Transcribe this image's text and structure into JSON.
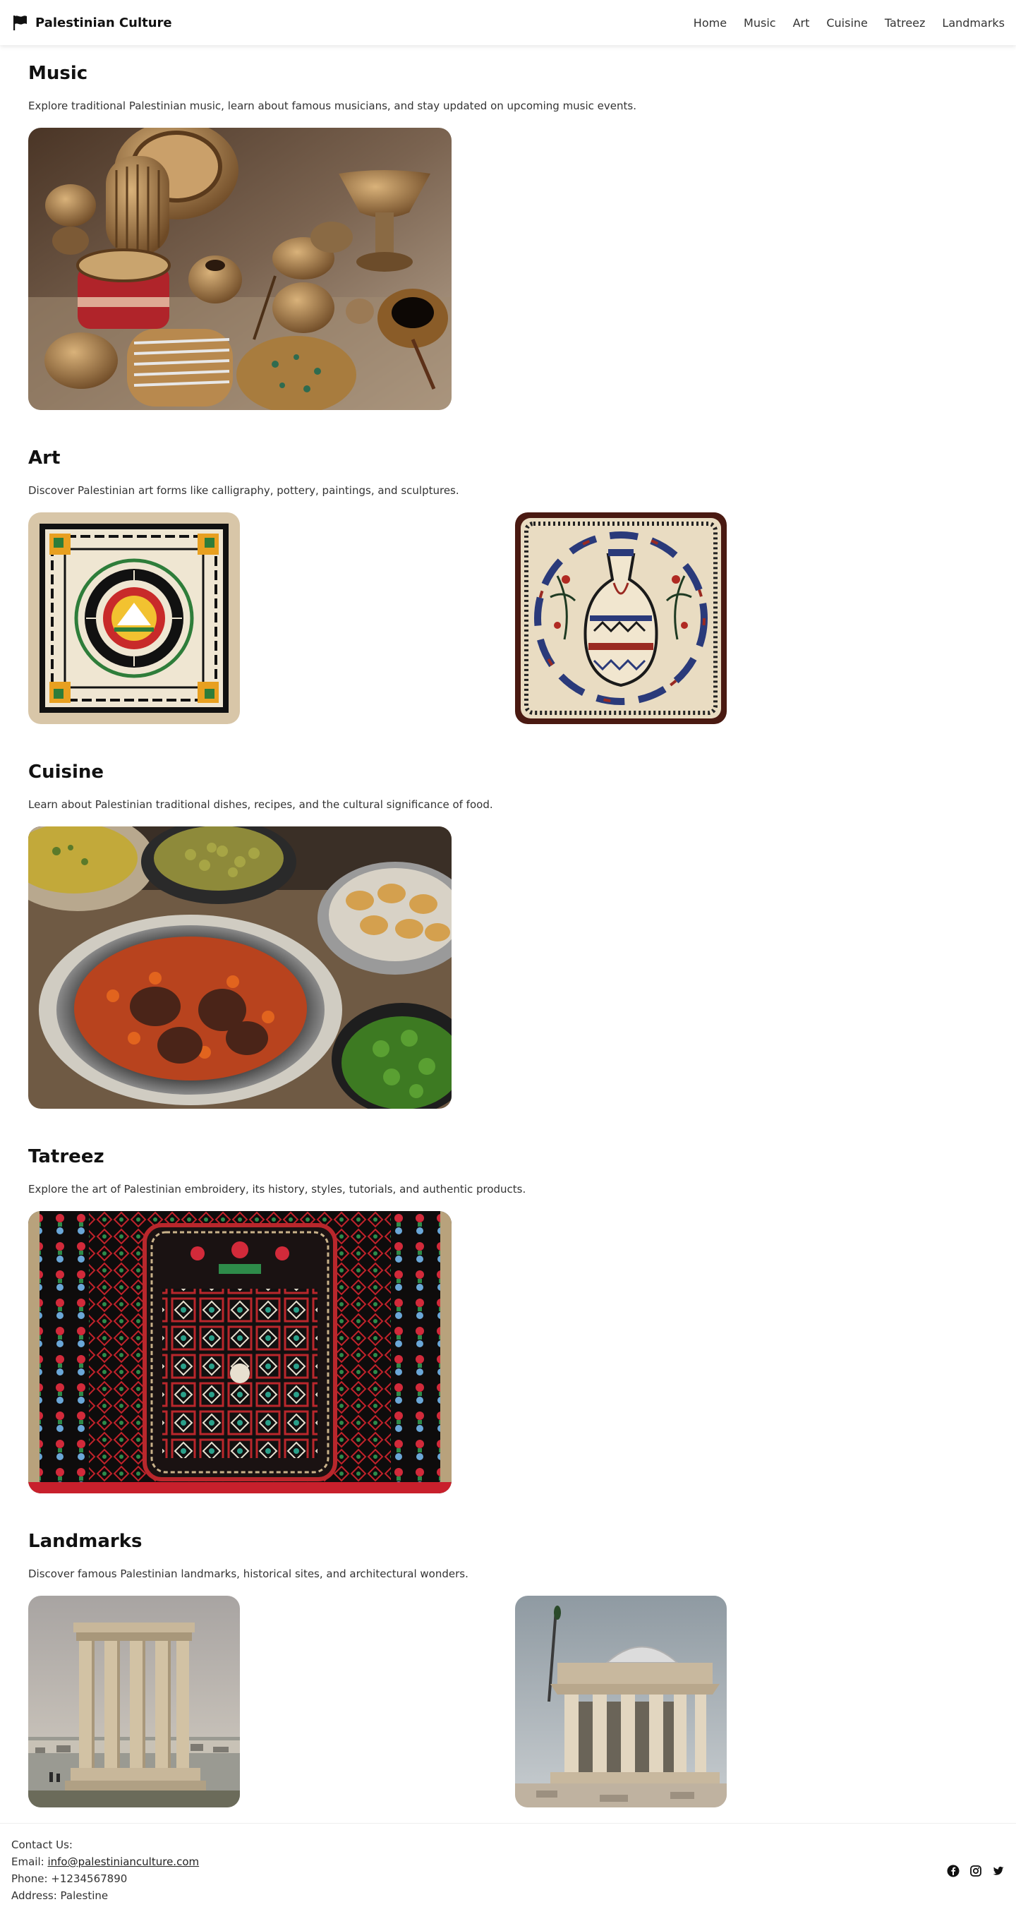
{
  "header": {
    "brand_title": "Palestinian Culture",
    "brand_icon": "flag-icon",
    "nav": [
      "Home",
      "Music",
      "Art",
      "Cuisine",
      "Tatreez",
      "Landmarks"
    ]
  },
  "sections": {
    "music": {
      "title": "Music",
      "description": "Explore traditional Palestinian music, learn about famous musicians, and stay updated on upcoming music events.",
      "images": [
        "traditional-instruments-photo"
      ]
    },
    "art": {
      "title": "Art",
      "description": "Discover Palestinian art forms like calligraphy, pottery, paintings, and sculptures.",
      "images": [
        "calligraphy-art-photo",
        "pottery-vase-art-photo"
      ]
    },
    "cuisine": {
      "title": "Cuisine",
      "description": "Learn about Palestinian traditional dishes, recipes, and the cultural significance of food.",
      "images": [
        "traditional-dishes-photo"
      ]
    },
    "tatreez": {
      "title": "Tatreez",
      "description": "Explore the art of Palestinian embroidery, its history, styles, tutorials, and authentic products.",
      "images": [
        "embroidery-photo"
      ]
    },
    "landmarks": {
      "title": "Landmarks",
      "description": "Discover famous Palestinian landmarks, historical sites, and architectural wonders.",
      "images": [
        "ancient-columns-photo",
        "domed-temple-photo"
      ]
    }
  },
  "footer": {
    "contact_heading": "Contact Us:",
    "email_label": "Email: ",
    "email": "info@palestinianculture.com",
    "phone": "Phone: +1234567890",
    "address": "Address: Palestine",
    "social_icons": [
      "facebook-icon",
      "instagram-icon",
      "twitter-icon"
    ]
  },
  "colors": {
    "text": "#1a1a1a",
    "muted": "#333333",
    "background": "#ffffff"
  }
}
